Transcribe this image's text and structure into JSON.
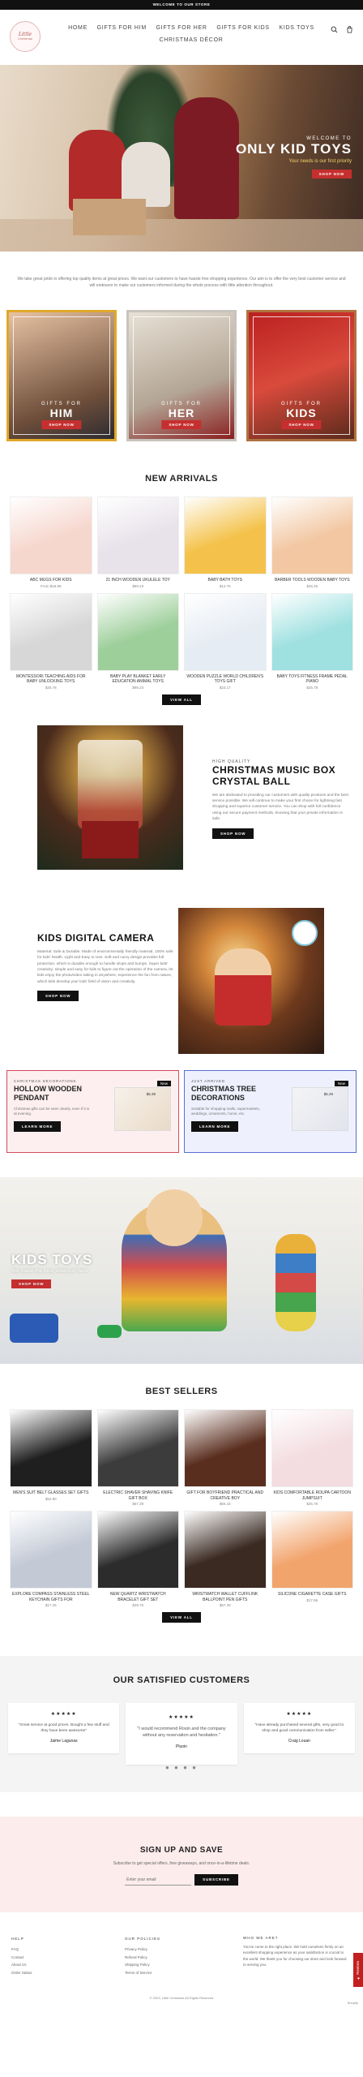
{
  "announcement": "WELCOME TO OUR STORE",
  "logo": {
    "line1": "Little",
    "line2": "Christmas"
  },
  "nav": [
    "HOME",
    "GIFTS FOR HIM",
    "GIFTS FOR HER",
    "GIFTS FOR KIDS",
    "KIDS TOYS",
    "CHRISTMAS DÉCOR"
  ],
  "hero": {
    "pretitle": "WELCOME TO",
    "title": "ONLY KID TOYS",
    "subtitle": "Your needs is our first priority",
    "button": "SHOP NOW"
  },
  "intro": "We take great pride in offering top quality items at great prices. We want our customers to have hassle free shopping experience. Our aim is to offer the very best customer service and will endeavor to make our customers informed during the whole process with little attention throughout.",
  "gift_cards": [
    {
      "for": "GIFTS FOR",
      "who": "HIM",
      "button": "SHOP NOW"
    },
    {
      "for": "GIFTS FOR",
      "who": "HER",
      "button": "SHOP NOW"
    },
    {
      "for": "GIFTS FOR",
      "who": "KIDS",
      "button": "SHOP NOW"
    }
  ],
  "new_arrivals": {
    "title": "NEW ARRIVALS",
    "button": "VIEW ALL",
    "products": [
      {
        "name": "ABC MUGS FOR KIDS",
        "price": "From $19.99",
        "color": "#f6d7ce"
      },
      {
        "name": "21 INCH WOODEN UKULELE TOY",
        "price": "$89.23",
        "color": "#e8e2ea"
      },
      {
        "name": "BABY BATH TOYS",
        "price": "$14.76",
        "color": "#f4c24a"
      },
      {
        "name": "BARBER TOOLS WOODEN BABY TOYS",
        "price": "$25.46",
        "color": "#f2c7a1"
      },
      {
        "name": "MONTESSORI TEACHING AIDS FOR BABY UNLOCKING TOYS",
        "price": "$25.78",
        "color": "#d7d7d7"
      },
      {
        "name": "BABY PLAY BLANKET EARLY EDUCATION ANIMAL TOYS",
        "price": "$89.23",
        "color": "#9dcf9a"
      },
      {
        "name": "WOODEN PUZZLE WORLD CHILDREN'S TOYS GIFT",
        "price": "$23.17",
        "color": "#e6ecf3"
      },
      {
        "name": "BABY TOYS FITNESS FRAME PEDAL PIANO",
        "price": "$25.78",
        "color": "#9fe0e0"
      }
    ]
  },
  "feature_music": {
    "pretitle": "HIGH QUALITY",
    "title": "CHRISTMAS MUSIC BOX CRYSTAL BALL",
    "text": "We are dedicated to providing our customers with quality products and the best service possible. We will continue to make your first choice for lightning fast shopping and superior customer service. You can shop with full confidence using our secure payment methods, knowing that your private information is safe.",
    "button": "SHOP NOW"
  },
  "feature_camera": {
    "title": "KIDS DIGITAL CAMERA",
    "text": "Material: Safe & Durable. Made of environmentally friendly material, 100% safe for kids' health. Light and Easy to Use. Soft and curvy design provides full protection, which is durable enough to handle drops and bumps. Super kids' creativity: simple and easy for kids to figure out the operation of the camera, let kids enjoy the photo/video taking in anywhere, experience the fun from nature, which kids develop your kids' field of vision and creativity.",
    "button": "SHOP NOW"
  },
  "promos": [
    {
      "pretitle": "CHRISTMAS DECORATIONS",
      "title": "HOLLOW WOODEN PENDANT",
      "text": "Christmas gifts can be seen clearly, even if it is at evening.",
      "button": "LEARN MORE",
      "tag": "New",
      "price": "$5.39"
    },
    {
      "pretitle": "JUST ARRIVED",
      "title": "CHRISTMAS TREE DECORATIONS",
      "text": "Suitable for shopping malls, supermarkets, weddings, ornaments, home, etc.",
      "button": "LEARN MORE",
      "tag": "New",
      "price": "$5.29"
    }
  ],
  "toys_banner": {
    "title": "KIDS TOYS",
    "subtitle": "We make the best selection here",
    "button": "SHOP NOW"
  },
  "best_sellers": {
    "title": "BEST SELLERS",
    "button": "VIEW ALL",
    "products": [
      {
        "name": "MEN'S SUIT BELT GLASSES SET GIFTS",
        "price": "$52.80",
        "color": "#1f1f1f"
      },
      {
        "name": "ELECTRIC SHAVER SHAVING KNIFE GIFT BOX",
        "price": "$67.39",
        "color": "#3c3c3c"
      },
      {
        "name": "GIFT FOR BOYFRIEND PRACTICAL AND CREATIVE BOY",
        "price": "$55.18",
        "color": "#5a2e1f"
      },
      {
        "name": "KIDS COMFORTABLE ROUPA CARTOON JUMPSUIT",
        "price": "$25.78",
        "color": "#f3dde1"
      },
      {
        "name": "EXPLORE COMPASS STAINLESS STEEL KEYCHAIN GIFTS FOR",
        "price": "$17.26",
        "color": "#c3cad6"
      },
      {
        "name": "NEW QUARTZ WRISTWATCH BRACELET GIFT SET",
        "price": "$29.76",
        "color": "#2c2c2c"
      },
      {
        "name": "WRISTWATCH WALLET CUFFLINK BALLPOINT PEN GIFTS",
        "price": "$57.49",
        "color": "#3a2a22"
      },
      {
        "name": "SILICONE CIGARETTE CASE GIFTS",
        "price": "$17.86",
        "color": "#f2a46d"
      }
    ]
  },
  "testimonials": {
    "title": "OUR SATISFIED CUSTOMERS",
    "items": [
      {
        "stars": "★★★★★",
        "text": "\"Great service at good prices. Bought a few stuff and they have been awesome\"",
        "name": "Jaime Lagunas"
      },
      {
        "stars": "★★★★★",
        "text": "\"I would recommend Rosin and the company without any reservation and hesitation.\"",
        "name": "Pluoin"
      },
      {
        "stars": "★★★★★",
        "text": "\"Have already purchased several gifts, very good to shop and good communication from seller.\"",
        "name": "Craig Louan"
      }
    ],
    "dots": "● ● ● ●"
  },
  "newsletter": {
    "title": "SIGN UP AND SAVE",
    "text": "Subscribe to get special offers, free giveaways, and once-in-a-lifetime deals.",
    "placeholder": "Enter your email",
    "button": "SUBSCRIBE"
  },
  "footer": {
    "help": {
      "title": "HELP",
      "links": [
        "FAQ",
        "Contact",
        "About Us",
        "Order Status"
      ]
    },
    "policies": {
      "title": "OUR POLICIES",
      "links": [
        "Privacy Policy",
        "Refund Policy",
        "Shipping Policy",
        "Terms of Service"
      ]
    },
    "about": {
      "title": "WHO WE ARE?",
      "text": "You've come to the right place. We hold ourselves firmly on an excellent shopping experience as your satisfaction is crucial to the world. We thank you for choosing our store and look forward to serving you."
    },
    "copyright": "© 2023, Little Christmas All Rights Reserved",
    "reviews_tab": "★ Reviews",
    "powered": "Shopify"
  }
}
